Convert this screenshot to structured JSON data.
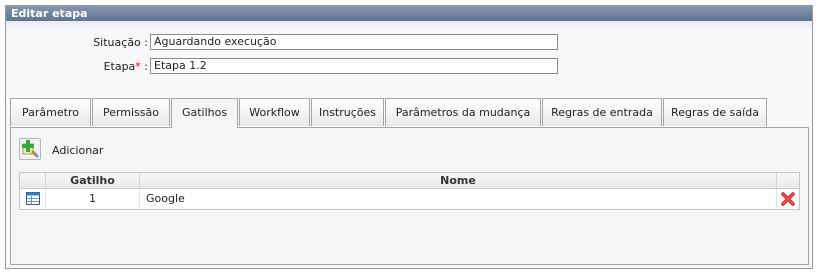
{
  "panel": {
    "title": "Editar etapa"
  },
  "form": {
    "situacao": {
      "label": "Situação :",
      "value": "Aguardando execução"
    },
    "etapa": {
      "label": "Etapa",
      "required_mark": "*",
      "separator": " :",
      "value": "Etapa 1.2"
    }
  },
  "tabs": [
    {
      "label": "Parâmetro"
    },
    {
      "label": "Permissão"
    },
    {
      "label": "Gatilhos",
      "active": true
    },
    {
      "label": "Workflow"
    },
    {
      "label": "Instruções"
    },
    {
      "label": "Parâmetros da mudança"
    },
    {
      "label": "Regras de entrada"
    },
    {
      "label": "Regras de saída"
    }
  ],
  "toolbar": {
    "add_label": "Adicionar",
    "add_icon": "add-green-plus-icon"
  },
  "grid": {
    "columns": [
      "Gatilho",
      "Nome"
    ],
    "rows": [
      {
        "gatilho": "1",
        "nome": "Google",
        "row_icon": "table-icon",
        "delete_icon": "delete-icon"
      }
    ]
  },
  "colors": {
    "header_gradient_top": "#8797b0",
    "header_gradient_bottom": "#5f7391",
    "required": "#e00000",
    "delete": "#d61f1f",
    "add": "#3aa53a"
  }
}
